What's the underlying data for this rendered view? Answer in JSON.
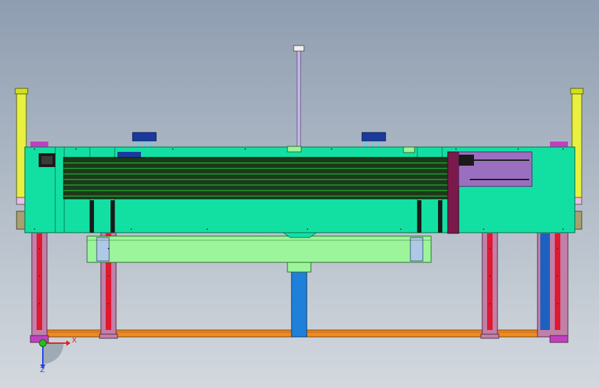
{
  "viewport": {
    "background_top": "#8e9db0",
    "background_bottom": "#d3d8de"
  },
  "model": {
    "colors": {
      "frame": "#12e0a3",
      "frame_edge": "#0a7a55",
      "belt": "#1a3a1a",
      "belt_stripe": "#2ecc40",
      "beam": "#9cf59a",
      "column": "#c080a8",
      "column_inner": "#e01830",
      "base_rail": "#ee8a22",
      "blue_post": "#1e80d8",
      "rod": "#c8b8e8",
      "cylinder": "#e8f040",
      "motor": "#1a3aa0",
      "purple_plate": "#9b6fc0",
      "maroon_plate": "#7a1a4a",
      "pink_bracket": "#e040e0",
      "cyan_rod": "#5fd0e0"
    },
    "components": [
      "conveyor-frame",
      "belt-module",
      "cross-beam",
      "support-columns",
      "base-rail",
      "center-post",
      "vertical-rod",
      "air-cylinders",
      "motors",
      "side-slide-module"
    ]
  },
  "triad": {
    "x_label": "X",
    "y_label": "Y",
    "z_label": "Z",
    "x_color": "#e02020",
    "y_color": "#20c020",
    "z_color": "#2040e0"
  }
}
